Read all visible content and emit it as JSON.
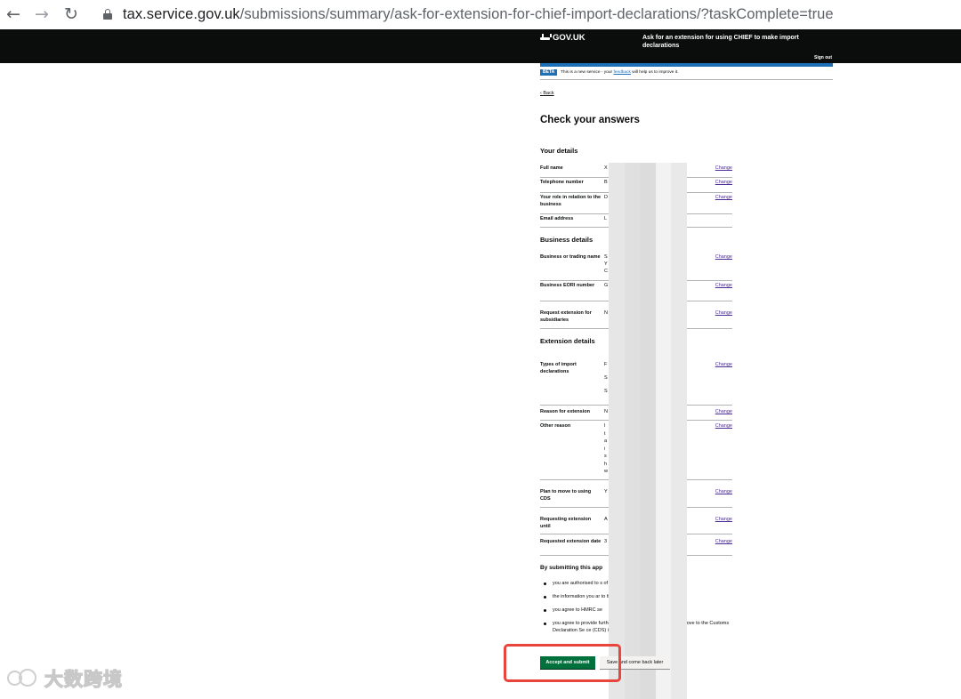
{
  "browser": {
    "url_host": "tax.service.gov.uk",
    "url_path": "/submissions/summary/ask-for-extension-for-chief-import-declarations/?taskComplete=true"
  },
  "header": {
    "logo": "GOV.UK",
    "service_name": "Ask for an extension for using CHIEF to make import declarations",
    "sign_out": "Sign out"
  },
  "phase_banner": {
    "tag": "BETA",
    "text_before": "This is a new service - your",
    "link": "feedback",
    "text_after": "will help us to improve it."
  },
  "back_link": "Back",
  "title": "Check your answers",
  "sections": {
    "your_details": {
      "heading": "Your details",
      "rows": [
        {
          "key": "Full name",
          "value": [
            "X"
          ],
          "action": "Change"
        },
        {
          "key": "Telephone number",
          "value": [
            "B"
          ],
          "action": "Change"
        },
        {
          "key": "Your role in relation to the business",
          "value": [
            "D"
          ],
          "action": "Change"
        },
        {
          "key": "Email address",
          "value": [
            "L"
          ],
          "action": ""
        }
      ]
    },
    "business_details": {
      "heading": "Business details",
      "rows": [
        {
          "key": "Business or trading name",
          "value": [
            "S",
            "Y",
            "C"
          ],
          "action": "Change"
        },
        {
          "key": "Business EORI number",
          "value": [
            "G"
          ],
          "action": "Change"
        },
        {
          "key": "Request extension for subsidiaries",
          "value": [
            "N"
          ],
          "action": "Change"
        }
      ]
    },
    "extension_details": {
      "heading": "Extension details",
      "rows": [
        {
          "key": "Types of import declarations",
          "value": [
            "F",
            "S",
            "S"
          ],
          "action": "Change"
        },
        {
          "key": "Reason for extension",
          "value": [
            "N"
          ],
          "action": "Change"
        },
        {
          "key": "Other reason",
          "value": [
            "I",
            "t",
            "a",
            "i",
            "s",
            "h",
            "w"
          ],
          "action": "Change"
        },
        {
          "key": "Plan to move to using CDS",
          "value": [
            "Y"
          ],
          "action": "Change"
        },
        {
          "key": "Requesting extension until",
          "value": [
            "A"
          ],
          "action": "Change"
        },
        {
          "key": "Requested extension date",
          "value": [
            "3"
          ],
          "action": "Change"
        }
      ]
    }
  },
  "submission": {
    "heading": "By submitting this app",
    "bullets": [
      "you are authorised to s                                   of SHENZHENSHI YUEC                                          TD",
      "the information you ar                                    to the best of your knowledge",
      "you agree to HMRC se",
      "you agree to provide further information about your plans to move to the Customs Declaration Se      ce (CDS) if we require this"
    ],
    "accept_button": "Accept and submit",
    "save_button": "Save and come back later"
  },
  "watermark": "大数跨境"
}
